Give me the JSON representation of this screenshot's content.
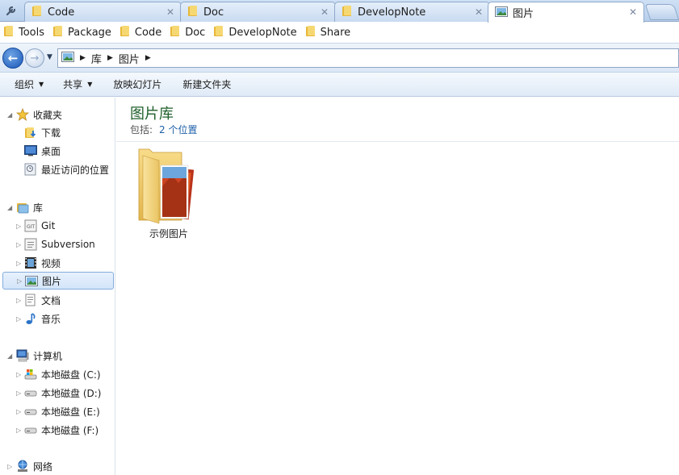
{
  "tabs": [
    {
      "label": "Code",
      "active": false
    },
    {
      "label": "Doc",
      "active": false
    },
    {
      "label": "DevelopNote",
      "active": false
    },
    {
      "label": "图片",
      "active": true
    }
  ],
  "bookmarks": [
    "Tools",
    "Package",
    "Code",
    "Doc",
    "DevelopNote",
    "Share"
  ],
  "address": {
    "crumbs": [
      "库",
      "图片"
    ]
  },
  "commands": [
    {
      "label": "组织",
      "dropdown": true
    },
    {
      "label": "共享",
      "dropdown": true
    },
    {
      "label": "放映幻灯片",
      "dropdown": false
    },
    {
      "label": "新建文件夹",
      "dropdown": false
    }
  ],
  "nav": {
    "favorites": {
      "label": "收藏夹",
      "items": [
        "下载",
        "桌面",
        "最近访问的位置"
      ]
    },
    "libraries": {
      "label": "库",
      "items": [
        "Git",
        "Subversion",
        "视频",
        "图片",
        "文档",
        "音乐"
      ],
      "selected": "图片"
    },
    "computer": {
      "label": "计算机",
      "items": [
        "本地磁盘 (C:)",
        "本地磁盘 (D:)",
        "本地磁盘 (E:)",
        "本地磁盘 (F:)"
      ]
    },
    "network": {
      "label": "网络"
    }
  },
  "content": {
    "title": "图片库",
    "includes_label": "包括:",
    "includes_link": "2 个位置",
    "items": [
      {
        "name": "示例图片"
      }
    ]
  },
  "colors": {
    "title_green": "#1f5f2a",
    "link_blue": "#1e5fa8",
    "selection_border": "#84acdd"
  }
}
